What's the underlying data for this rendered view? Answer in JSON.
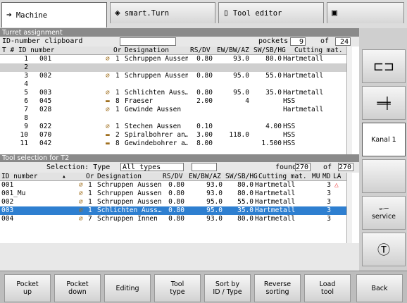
{
  "tabs": [
    {
      "label": "Machine",
      "icon": "right-arrow-icon"
    },
    {
      "label": "smart.Turn",
      "icon": "diamond-arrow-icon"
    },
    {
      "label": "Tool editor",
      "icon": "document-icon"
    },
    {
      "label": "",
      "icon": "floppy-icon"
    }
  ],
  "turret": {
    "title": "Turret assignment",
    "clipboard_label": "ID-number clipboard",
    "clipboard_value": "",
    "pockets_label": "pockets",
    "pockets_value": "9",
    "of_label": "of",
    "of_value": "24",
    "headers": [
      "T #",
      "ID number",
      "Or",
      "Designation",
      "RS/DV",
      "EW/BW/AZ",
      "SW/SB/HG",
      "Cutting mat."
    ],
    "rows": [
      {
        "t": "1",
        "id": "001",
        "icon": "tool-icon",
        "or": "1",
        "des": "Schruppen Aussen",
        "rs": "0.80",
        "ew": "93.0",
        "sw": "80.0",
        "mat": "Hartmetall",
        "hl": true
      },
      {
        "t": "2",
        "id": "",
        "icon": "",
        "or": "",
        "des": "",
        "rs": "",
        "ew": "",
        "sw": "",
        "mat": "",
        "grey": true
      },
      {
        "t": "3",
        "id": "002",
        "icon": "tool-icon",
        "or": "1",
        "des": "Schruppen Aussen",
        "rs": "0.80",
        "ew": "95.0",
        "sw": "55.0",
        "mat": "Hartmetall"
      },
      {
        "t": "4",
        "id": "",
        "icon": "",
        "or": "",
        "des": "",
        "rs": "",
        "ew": "",
        "sw": "",
        "mat": ""
      },
      {
        "t": "5",
        "id": "003",
        "icon": "tool-icon",
        "or": "1",
        "des": "Schlichten Auss…",
        "rs": "0.80",
        "ew": "95.0",
        "sw": "35.0",
        "mat": "Hartmetall"
      },
      {
        "t": "6",
        "id": "045",
        "icon": "drill-icon",
        "or": "8",
        "des": "Fraeser",
        "rs": "2.00",
        "ew": "4",
        "sw": "",
        "mat": "HSS"
      },
      {
        "t": "7",
        "id": "028",
        "icon": "tool-icon",
        "or": "1",
        "des": "Gewinde Aussen",
        "rs": "",
        "ew": "",
        "sw": "",
        "mat": "Hartmetall"
      },
      {
        "t": "8",
        "id": "",
        "icon": "",
        "or": "",
        "des": "",
        "rs": "",
        "ew": "",
        "sw": "",
        "mat": ""
      },
      {
        "t": "9",
        "id": "022",
        "icon": "tool-icon",
        "or": "1",
        "des": "Stechen Aussen",
        "rs": "0.10",
        "ew": "",
        "sw": "4.00",
        "mat": "HSS"
      },
      {
        "t": "10",
        "id": "070",
        "icon": "drill-icon",
        "or": "2",
        "des": "Spiralbohrer an…",
        "rs": "3.00",
        "ew": "118.0",
        "sw": "",
        "mat": "HSS"
      },
      {
        "t": "11",
        "id": "042",
        "icon": "drill-icon",
        "or": "8",
        "des": "Gewindebohrer a…",
        "rs": "8.00",
        "ew": "",
        "sw": "1.500",
        "mat": "HSS"
      }
    ]
  },
  "selection": {
    "title": "Tool selection for T2",
    "selection_label": "Selection: Type",
    "type_value": "All types",
    "extra_value": "",
    "found_label": "found",
    "found_value": "270",
    "of_label": "of",
    "of_value": "270",
    "headers": [
      "ID number",
      "Or",
      "Designation",
      "RS/DV",
      "EW/BW/AZ",
      "SW/SB/HG",
      "Cutting mat.",
      "MU",
      "MD",
      "LA"
    ],
    "rows": [
      {
        "id": "001",
        "or": "1",
        "des": "Schruppen Aussen",
        "rs": "0.80",
        "ew": "93.0",
        "sw": "80.0",
        "mat": "Hartmetall",
        "md": "3",
        "la": "△"
      },
      {
        "id": "001_Mu",
        "or": "1",
        "des": "Schruppen Aussen",
        "rs": "0.80",
        "ew": "93.0",
        "sw": "80.0",
        "mat": "Hartmetall",
        "md": "3",
        "la": ""
      },
      {
        "id": "002",
        "or": "1",
        "des": "Schruppen Aussen",
        "rs": "0.80",
        "ew": "95.0",
        "sw": "55.0",
        "mat": "Hartmetall",
        "md": "3",
        "la": ""
      },
      {
        "id": "003",
        "or": "1",
        "des": "Schlichten Auss…",
        "rs": "0.80",
        "ew": "95.0",
        "sw": "35.0",
        "mat": "Hartmetall",
        "md": "3",
        "la": "",
        "sel": true
      },
      {
        "id": "004",
        "or": "7",
        "des": "Schruppen Innen",
        "rs": "0.80",
        "ew": "93.0",
        "sw": "80.0",
        "mat": "Hartmetall",
        "md": "3",
        "la": ""
      }
    ]
  },
  "side": [
    "",
    "",
    "Kanal 1",
    "",
    "service",
    ""
  ],
  "footer": [
    "Pocket\nup",
    "Pocket\ndown",
    "Editing",
    "Tool\ntype",
    "Sort by\nID / Type",
    "Reverse\nsorting",
    "Load\ntool",
    "Back"
  ]
}
